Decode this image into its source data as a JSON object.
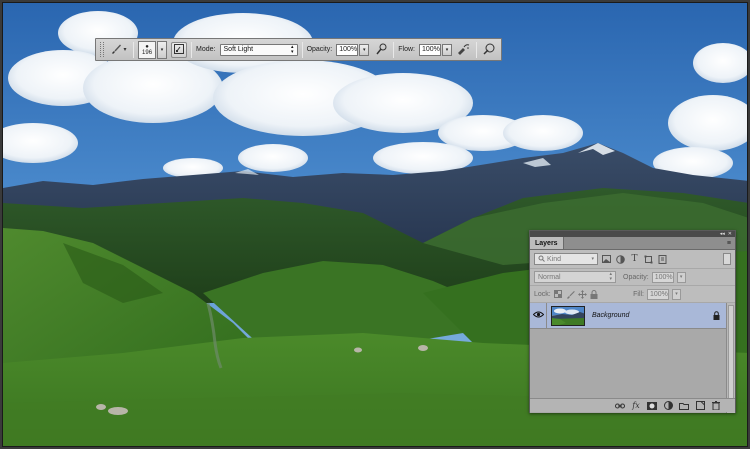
{
  "options_bar": {
    "brush_size": "196",
    "mode_label": "Mode:",
    "mode_value": "Soft Light",
    "opacity_label": "Opacity:",
    "opacity_value": "100%",
    "flow_label": "Flow:",
    "flow_value": "100%",
    "icons": [
      "brush-tool-icon",
      "brush-preset-picker",
      "toggle-brush-panel-icon",
      "pressure-opacity-icon",
      "airbrush-icon",
      "pressure-size-icon"
    ]
  },
  "layers_panel": {
    "title": "Layers",
    "filter_kind": "Kind",
    "blend_mode": "Normal",
    "opacity_label": "Opacity:",
    "opacity_value": "100%",
    "lock_label": "Lock:",
    "fill_label": "Fill:",
    "fill_value": "100%",
    "layers": [
      {
        "name": "Background",
        "visible": true,
        "locked": true,
        "selected": true
      }
    ],
    "footer_icons": [
      "link-layers-icon",
      "fx-icon",
      "layer-mask-icon",
      "adjustment-layer-icon",
      "new-group-icon",
      "new-layer-icon",
      "delete-layer-icon"
    ],
    "footer_fx": "fx"
  },
  "colors": {
    "panel_bg": "#bdbdbd",
    "selected_layer": "#a9b8d8",
    "sky": "#3b7fc9",
    "grass": "#3e7a25"
  }
}
